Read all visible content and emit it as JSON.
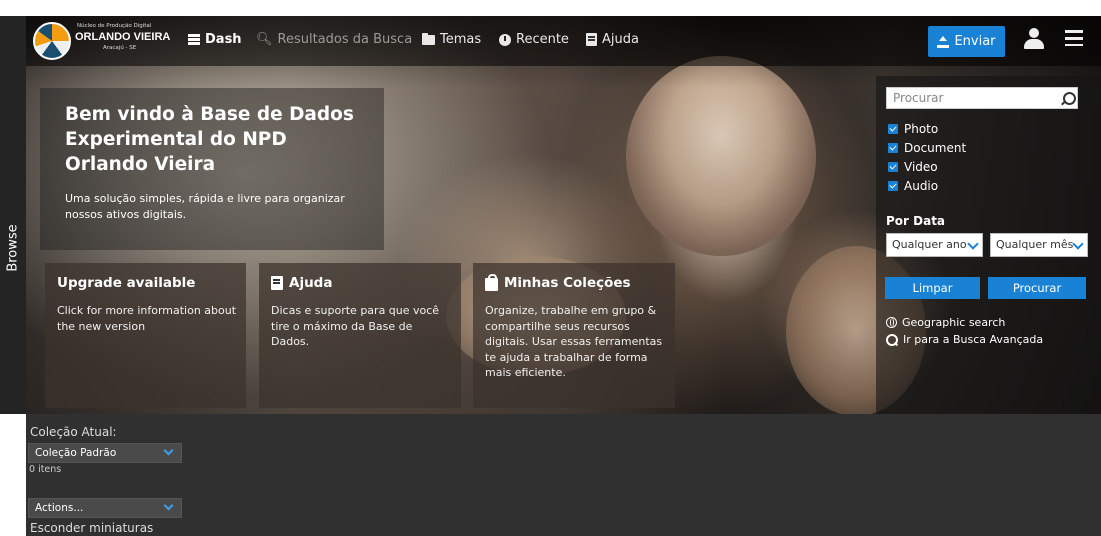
{
  "logo": {
    "small_text": "Núcleo de Produção Digital",
    "name": "ORLANDO VIEIRA",
    "city": "Aracajú - SE"
  },
  "nav": {
    "dash": "Dash",
    "results": "Resultados da Busca",
    "temas": "Temas",
    "recente": "Recente",
    "ajuda": "Ajuda",
    "enviar": "Enviar"
  },
  "browse_tab": "Browse",
  "welcome": {
    "title": "Bem vindo à Base de Dados Experimental do NPD Orlando Vieira",
    "subtitle": "Uma solução simples, rápida e livre para organizar nossos ativos digitais."
  },
  "boxes": [
    {
      "title": "Upgrade available",
      "body": "Click for more information about the new version"
    },
    {
      "title": "Ajuda",
      "body": "Dicas e suporte para que você tire o máximo da Base de Dados."
    },
    {
      "title": "Minhas Coleções",
      "body": "Organize, trabalhe em grupo & compartilhe seus recursos digitais. Usar essas ferramentas te ajuda a trabalhar de forma mais eficiente."
    }
  ],
  "search": {
    "placeholder": "Procurar",
    "filters": [
      {
        "label": "Photo",
        "checked": true
      },
      {
        "label": "Document",
        "checked": true
      },
      {
        "label": "Video",
        "checked": true
      },
      {
        "label": "Audio",
        "checked": true
      }
    ],
    "por_data": "Por Data",
    "year_select": "Qualquer ano",
    "month_select": "Qualquer mês",
    "limpar": "Limpar",
    "procurar": "Procurar",
    "geo": "Geographic search",
    "advanced": "Ir para a Busca Avançada"
  },
  "collection": {
    "label": "Coleção Atual:",
    "selected": "Coleção Padrão",
    "count": "0 itens",
    "actions": "Actions...",
    "hide_thumbs": "Esconder miniaturas"
  },
  "colors": {
    "accent": "#1a82d4",
    "bar_bg": "#303030"
  }
}
